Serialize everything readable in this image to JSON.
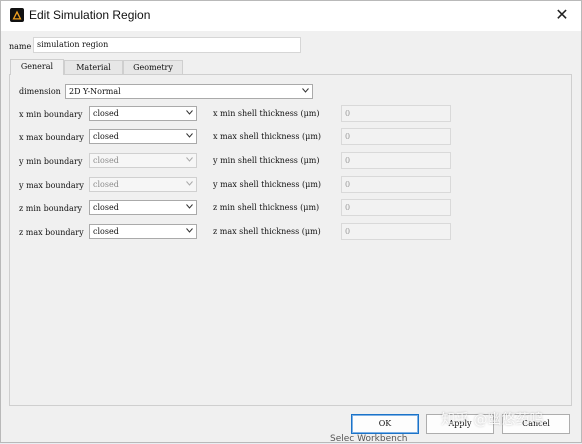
{
  "window": {
    "title": "Edit Simulation Region",
    "close_glyph": "✕"
  },
  "name_field": {
    "label": "name",
    "value": "simulation region"
  },
  "tabs": [
    {
      "label": "General",
      "active": true
    },
    {
      "label": "Material",
      "active": false
    },
    {
      "label": "Geometry",
      "active": false
    }
  ],
  "dimension": {
    "label": "dimension",
    "value": "2D Y-Normal"
  },
  "boundaries": [
    {
      "label": "x min boundary",
      "value": "closed",
      "enabled": true,
      "thickness_label": "x min shell thickness (μm)",
      "thickness_value": "0"
    },
    {
      "label": "x max boundary",
      "value": "closed",
      "enabled": true,
      "thickness_label": "x max shell thickness (μm)",
      "thickness_value": "0"
    },
    {
      "label": "y min boundary",
      "value": "closed",
      "enabled": false,
      "thickness_label": "y min shell thickness (μm)",
      "thickness_value": "0"
    },
    {
      "label": "y max boundary",
      "value": "closed",
      "enabled": false,
      "thickness_label": "y max shell thickness (μm)",
      "thickness_value": "0"
    },
    {
      "label": "z min boundary",
      "value": "closed",
      "enabled": true,
      "thickness_label": "z min shell thickness (μm)",
      "thickness_value": "0"
    },
    {
      "label": "z max boundary",
      "value": "closed",
      "enabled": true,
      "thickness_label": "z max shell thickness (μm)",
      "thickness_value": "0"
    }
  ],
  "buttons": {
    "ok": "OK",
    "apply": "Apply",
    "cancel": "Cancel"
  },
  "watermark": "知乎 @幽悠药鸣",
  "below_text": "Selec Workbench",
  "colors": {
    "primary_border": "#1b73c8",
    "background": "#f0f0f0"
  }
}
